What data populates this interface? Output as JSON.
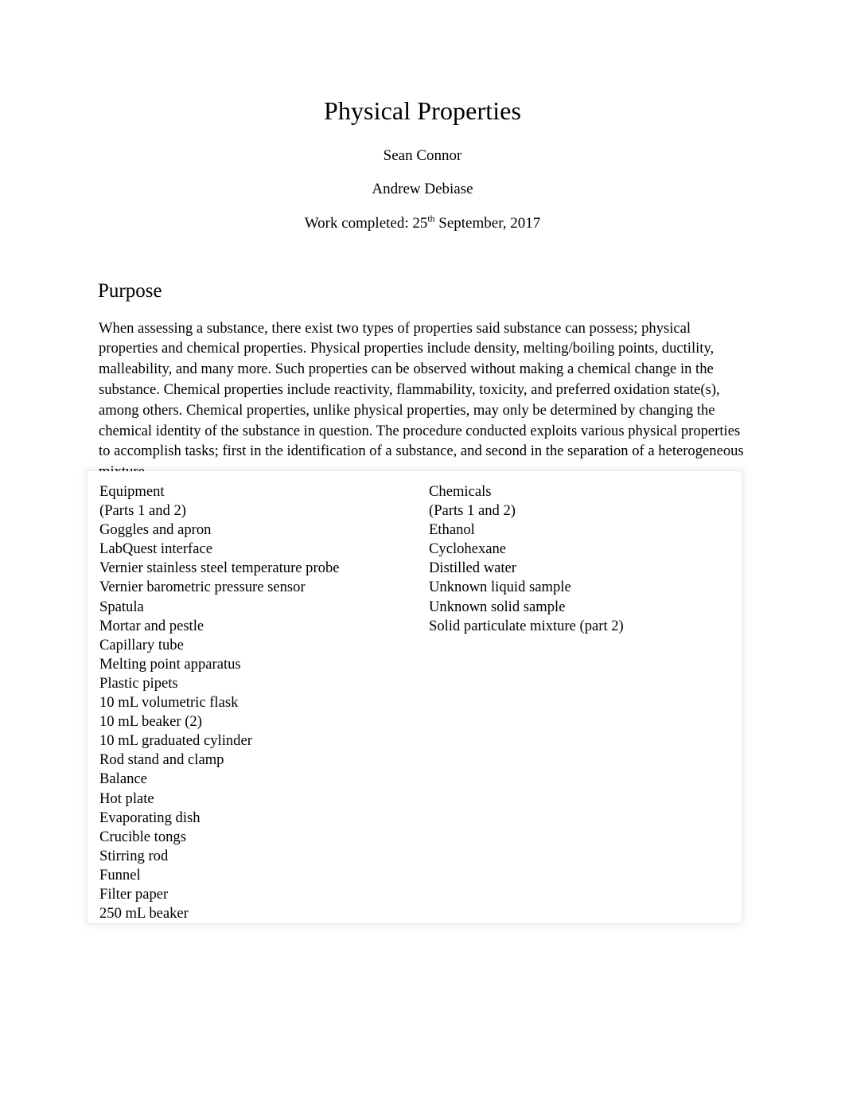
{
  "document": {
    "title": "Physical Properties",
    "authors": [
      "Sean Connor",
      "Andrew Debiase"
    ],
    "date_prefix": "Work completed: 25",
    "date_ordinal": "th",
    "date_suffix": " September, 2017"
  },
  "purpose": {
    "heading": "Purpose",
    "body": "When assessing a substance, there exist two types of properties said substance can possess; physical properties and chemical properties. Physical properties include density, melting/boiling points, ductility, malleability, and many more. Such properties can be observed without making a chemical change in the substance. Chemical properties include reactivity, flammability, toxicity, and preferred oxidation state(s), among others. Chemical properties, unlike physical properties, may only be determined by changing the chemical identity of the substance in question. The procedure conducted exploits various physical properties to accomplish tasks; first in the identification of a substance, and second in the separation of a heterogeneous mixture."
  },
  "materials_table": {
    "columns": [
      {
        "header": "Equipment",
        "subheader": "(Parts 1 and 2)",
        "items": [
          "Goggles and apron",
          "LabQuest interface",
          "Vernier stainless steel temperature probe",
          "Vernier barometric pressure sensor",
          "Spatula",
          "Mortar and pestle",
          "Capillary tube",
          "Melting point apparatus",
          "Plastic pipets",
          "10 mL volumetric flask",
          "10 mL beaker (2)",
          "10 mL graduated cylinder",
          "Rod stand and clamp",
          "Balance",
          "Hot plate",
          "Evaporating dish",
          "Crucible tongs",
          "Stirring rod",
          "Funnel",
          "Filter paper",
          "250 mL beaker"
        ]
      },
      {
        "header": "Chemicals",
        "subheader": "(Parts 1 and 2)",
        "items": [
          "Ethanol",
          "Cyclohexane",
          "Distilled water",
          "Unknown liquid sample",
          "Unknown solid sample",
          "Solid particulate mixture (part 2)"
        ]
      }
    ]
  },
  "colors": {
    "page_background": "#ffffff",
    "text": "#000000",
    "table_frame": "#d9d9d9"
  }
}
